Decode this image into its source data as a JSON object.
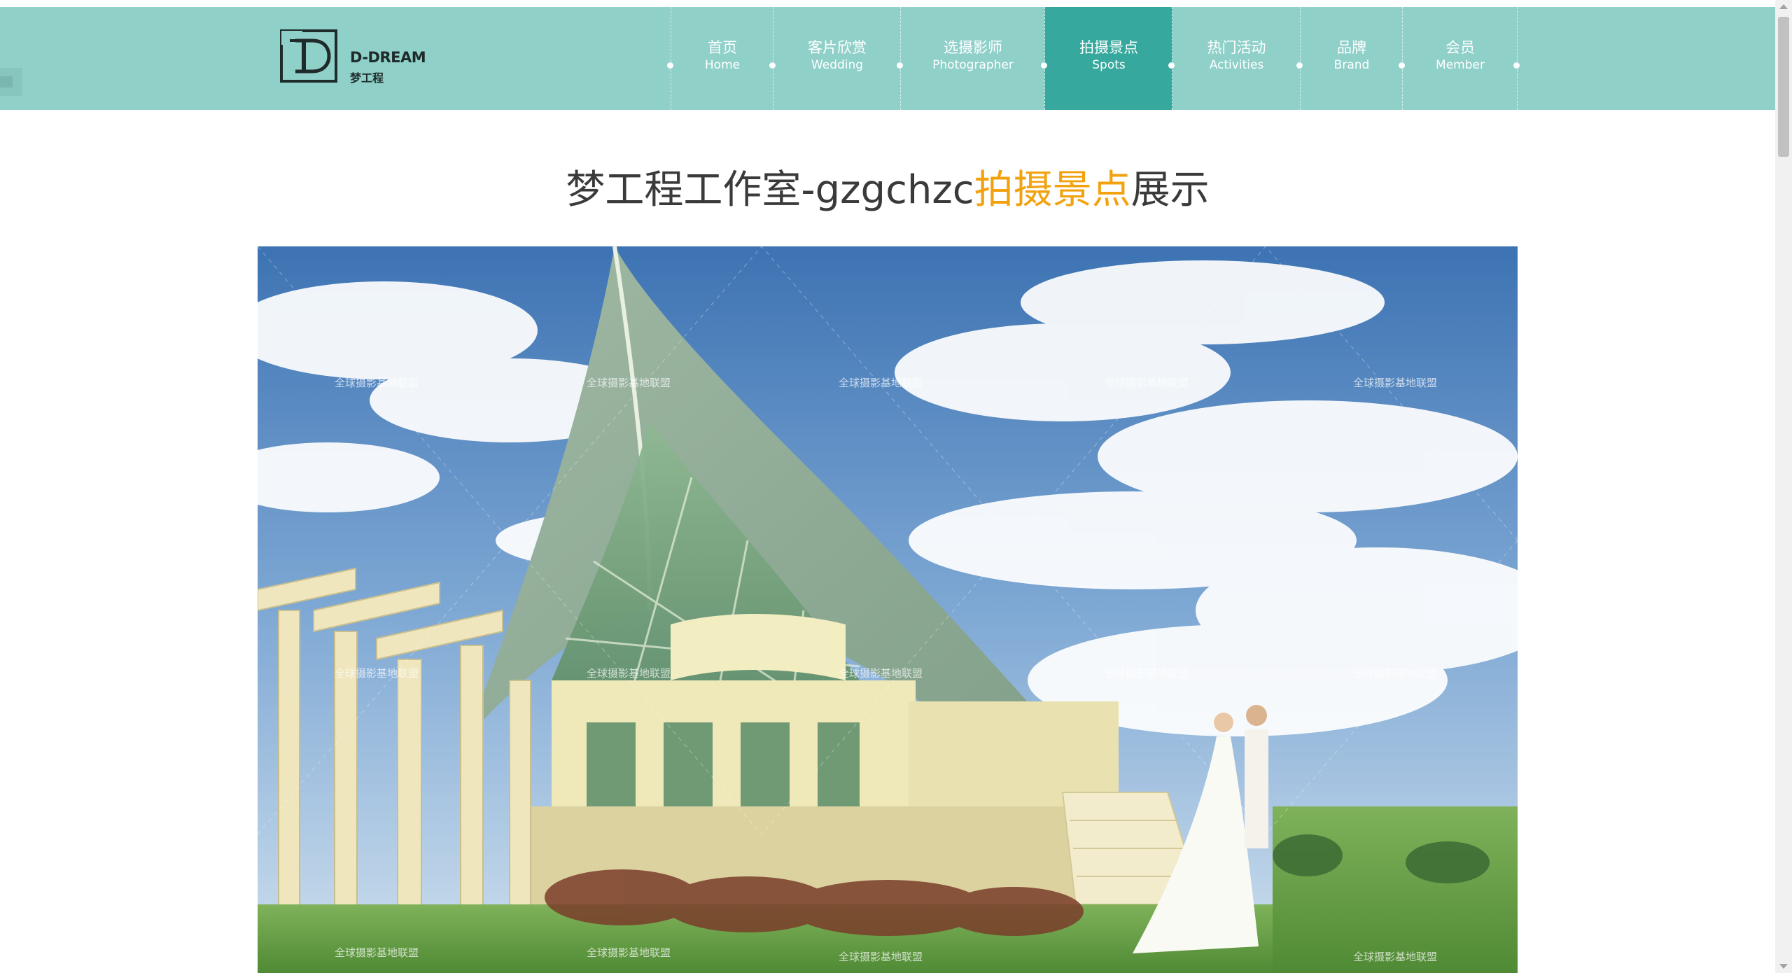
{
  "brand": {
    "en": "D-DREAM",
    "cn": "梦工程"
  },
  "nav": [
    {
      "cn": "首页",
      "en": "Home",
      "active": false
    },
    {
      "cn": "客片欣赏",
      "en": "Wedding",
      "active": false
    },
    {
      "cn": "选摄影师",
      "en": "Photographer",
      "active": false
    },
    {
      "cn": "拍摄景点",
      "en": "Spots",
      "active": true
    },
    {
      "cn": "热门活动",
      "en": "Activities",
      "active": false
    },
    {
      "cn": "品牌",
      "en": "Brand",
      "active": false
    },
    {
      "cn": "会员",
      "en": "Member",
      "active": false
    }
  ],
  "page": {
    "title_prefix": "梦工程工作室-gzgchzc",
    "title_highlight": "拍摄景点",
    "title_suffix": "展示"
  },
  "photo": {
    "watermark": "全球摄影基地联盟"
  },
  "colors": {
    "header_bg": "#8fd0c9",
    "nav_active_bg": "#36a89d",
    "title_highlight": "#f2a20f",
    "title_text": "#3a3a3a"
  }
}
